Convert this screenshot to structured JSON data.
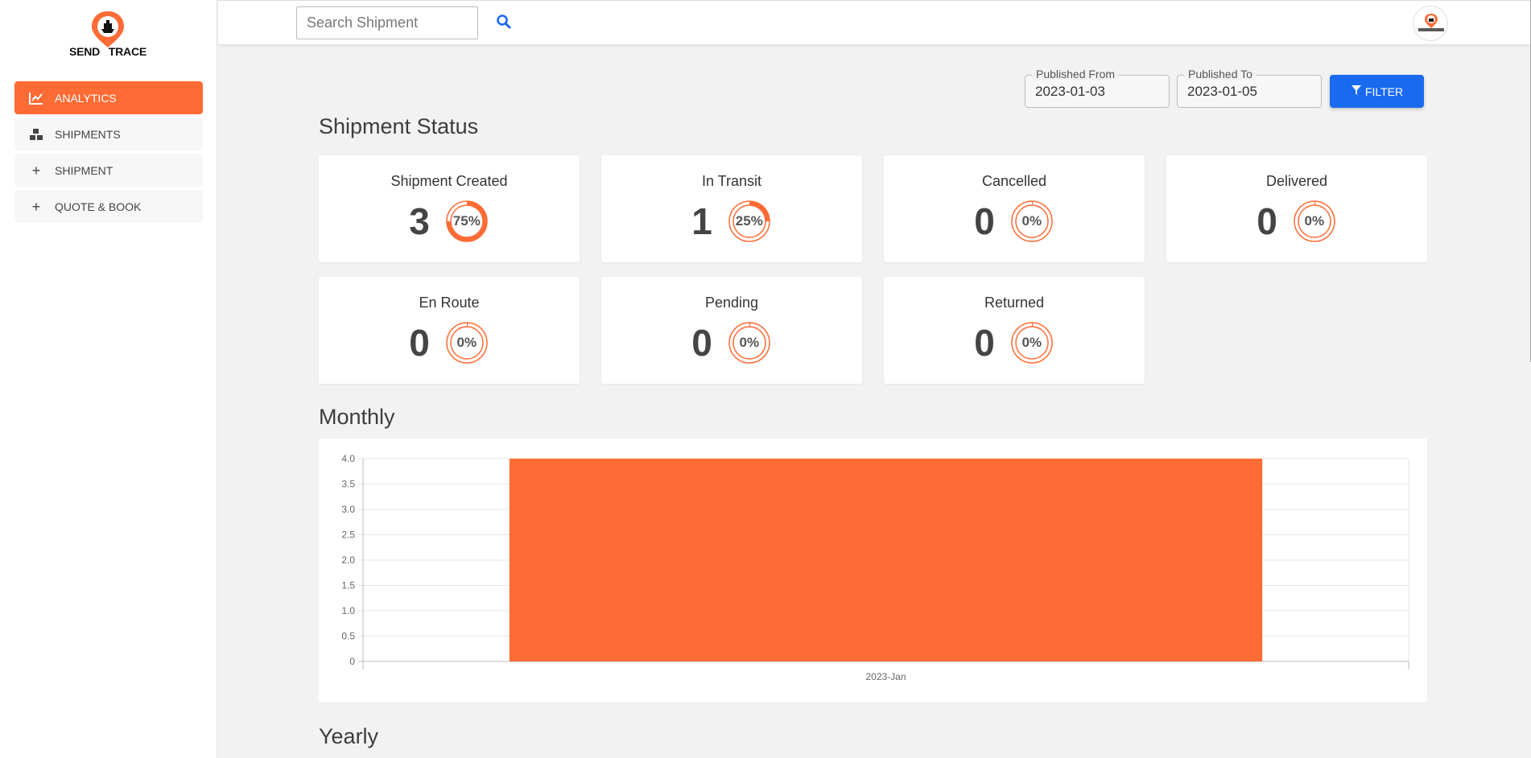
{
  "brand": {
    "logo_send": "SEND",
    "logo_trace": "TRACE"
  },
  "colors": {
    "accent": "#ff6b35",
    "primary": "#1a6af0",
    "background": "#f2f2f2"
  },
  "sidebar": {
    "items": [
      {
        "label": "ANALYTICS",
        "icon": "chart-line-icon",
        "active": true
      },
      {
        "label": "SHIPMENTS",
        "icon": "boxes-icon",
        "active": false
      },
      {
        "label": "SHIPMENT",
        "icon": "plus-icon",
        "active": false
      },
      {
        "label": "QUOTE & BOOK",
        "icon": "plus-icon",
        "active": false
      }
    ]
  },
  "topbar": {
    "search_placeholder": "Search Shipment",
    "search_icon": "search-icon",
    "avatar_icon": "user-avatar-icon"
  },
  "filters": {
    "from_label": "Published From",
    "from_value": "2023-01-03",
    "to_label": "Published To",
    "to_value": "2023-01-05",
    "filter_label": "FILTER",
    "filter_icon": "funnel-icon"
  },
  "status": {
    "title": "Shipment Status",
    "cards": [
      {
        "title": "Shipment Created",
        "count": "3",
        "percent_label": "75%",
        "percent": 75
      },
      {
        "title": "In Transit",
        "count": "1",
        "percent_label": "25%",
        "percent": 25
      },
      {
        "title": "Cancelled",
        "count": "0",
        "percent_label": "0%",
        "percent": 0
      },
      {
        "title": "Delivered",
        "count": "0",
        "percent_label": "0%",
        "percent": 0
      },
      {
        "title": "En Route",
        "count": "0",
        "percent_label": "0%",
        "percent": 0
      },
      {
        "title": "Pending",
        "count": "0",
        "percent_label": "0%",
        "percent": 0
      },
      {
        "title": "Returned",
        "count": "0",
        "percent_label": "0%",
        "percent": 0
      }
    ]
  },
  "monthly": {
    "title": "Monthly"
  },
  "yearly": {
    "title": "Yearly"
  },
  "chart_data": {
    "type": "bar",
    "title": "",
    "categories": [
      "2023-Jan"
    ],
    "values": [
      4
    ],
    "ylim": [
      0,
      4
    ],
    "yticks": [
      "0",
      "0.5",
      "1.0",
      "1.5",
      "2.0",
      "2.5",
      "3.0",
      "3.5",
      "4.0"
    ],
    "grid": true,
    "bar_color": "#ff6b35",
    "xlabel": "",
    "ylabel": ""
  }
}
